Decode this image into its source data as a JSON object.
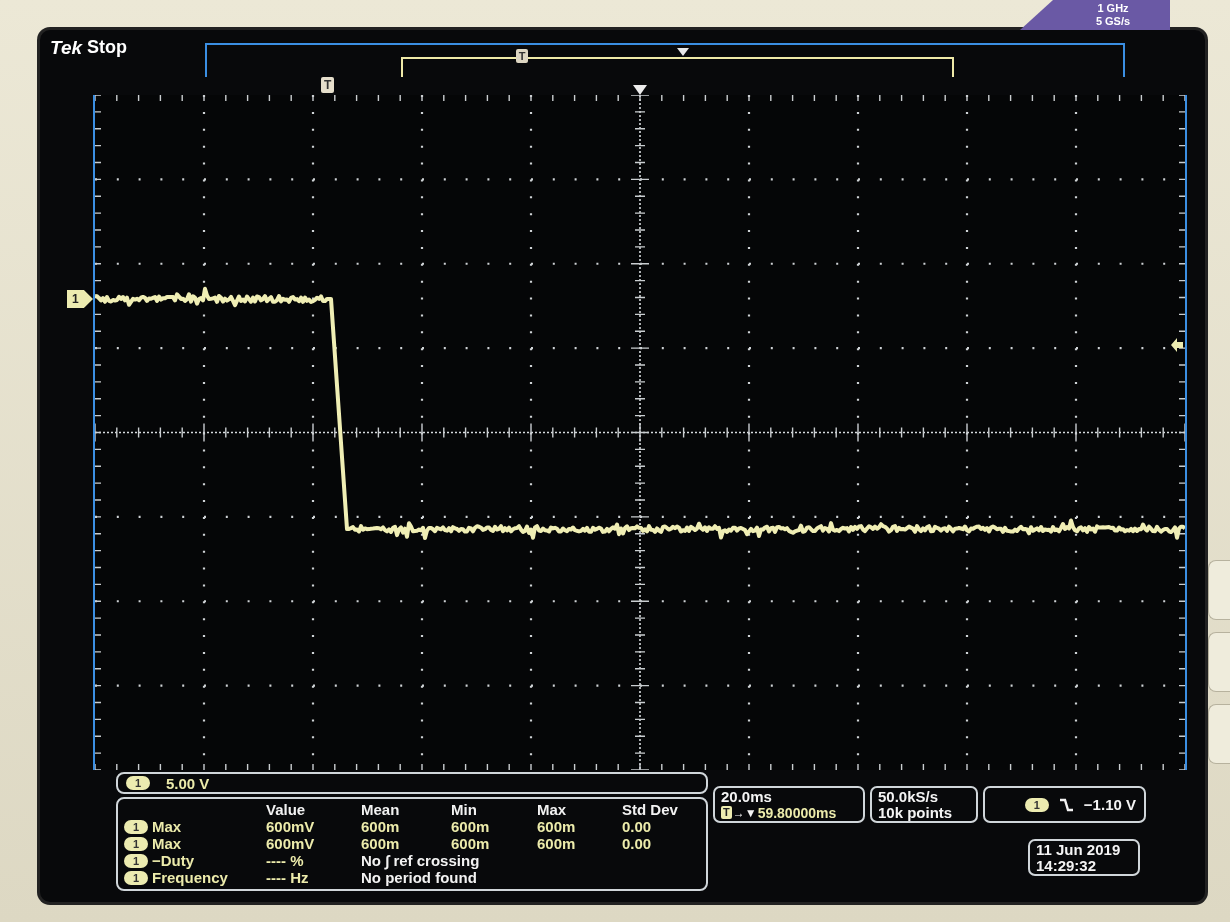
{
  "bezel": {
    "badge": {
      "bandwidth": "1 GHz",
      "sample_rate": "5 GS/s"
    }
  },
  "status": {
    "brand": "Tek",
    "acquisition": "Stop"
  },
  "record_view": {
    "trigger_marker": "T"
  },
  "graticule": {
    "trigger_marker": "T",
    "channel_marker": "1"
  },
  "channel_readout": {
    "channel": "1",
    "scale": "5.00 V"
  },
  "measurements": {
    "columns": [
      "Value",
      "Mean",
      "Min",
      "Max",
      "Std Dev"
    ],
    "rows": [
      {
        "kind": "stats",
        "channel": "1",
        "name": "Max",
        "value": "600mV",
        "mean": "600m",
        "min": "600m",
        "max": "600m",
        "std_dev": "0.00"
      },
      {
        "kind": "stats",
        "channel": "1",
        "name": "Max",
        "value": "600mV",
        "mean": "600m",
        "min": "600m",
        "max": "600m",
        "std_dev": "0.00"
      },
      {
        "kind": "message",
        "channel": "1",
        "name": "−Duty",
        "value": "---- %",
        "message": "No ∫ ref crossing"
      },
      {
        "kind": "message",
        "channel": "1",
        "name": "Frequency",
        "value": "---- Hz",
        "message": "No period found"
      }
    ]
  },
  "timebase": {
    "scale": "20.0ms",
    "marker": "T",
    "arrows": "→▼",
    "delay": "59.80000ms"
  },
  "acquisition": {
    "sample_rate": "50.0kS/s",
    "record_length": "10k points"
  },
  "trigger": {
    "channel": "1",
    "falling": true,
    "level": "−1.10 V"
  },
  "datetime": {
    "date": "11 Jun 2019",
    "time": "14:29:32"
  }
}
